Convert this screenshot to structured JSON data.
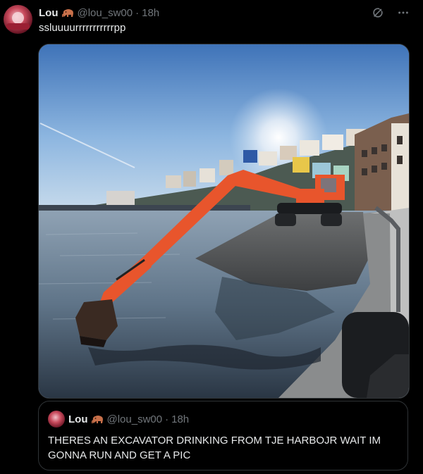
{
  "post": {
    "author": {
      "display_name": "Lou",
      "emoji": "mammoth-emoji",
      "handle": "@lou_sw00",
      "separator": "·",
      "time": "18h"
    },
    "actions": [
      {
        "icon": "grok-icon"
      },
      {
        "icon": "more-icon"
      }
    ],
    "text": "ssluuuurrrrrrrrrrrpp",
    "media": {
      "type": "photo",
      "icon": "photo-excavator-in-harbour"
    },
    "quoted_post": {
      "author": {
        "display_name": "Lou",
        "emoji": "mammoth-emoji",
        "handle": "@lou_sw00",
        "separator": "·",
        "time": "18h"
      },
      "text": "THERES AN EXCAVATOR DRINKING FROM TJE HARBOJR WAIT IM GONNA RUN AND GET A PIC"
    }
  },
  "colors": {
    "background": "#000000",
    "text_primary": "#e7e9ea",
    "text_secondary": "#71767b",
    "border": "#2f3336",
    "excavator": "#e8552c"
  }
}
